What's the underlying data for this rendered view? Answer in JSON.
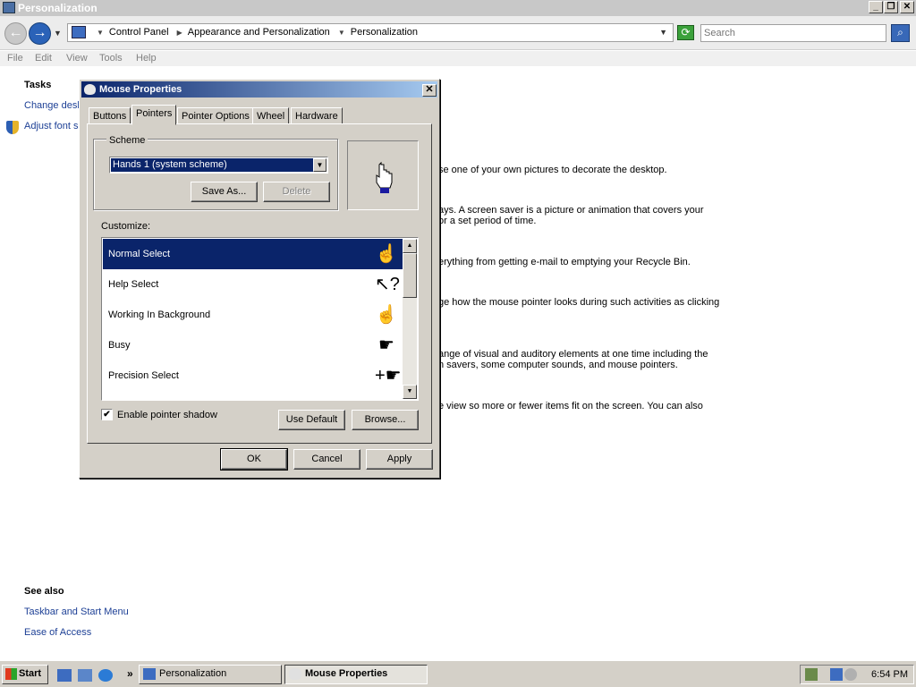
{
  "window": {
    "title": "Personalization",
    "controls": {
      "minimize": "_",
      "maximize": "❐",
      "close": "✕"
    }
  },
  "address": {
    "breadcrumbs": [
      "Control Panel",
      "Appearance and Personalization",
      "Personalization"
    ],
    "search_placeholder": "Search"
  },
  "menu": [
    "File",
    "Edit",
    "View",
    "Tools",
    "Help"
  ],
  "page": {
    "tasks_heading": "Tasks",
    "tasks": [
      "Change desk",
      "Adjust font s"
    ],
    "descriptions": [
      "se one of your own pictures to decorate the desktop.",
      "ays. A screen saver is a picture or animation that covers your",
      "or a set period of time.",
      "erything from getting e-mail to emptying your Recycle Bin.",
      "ge how the mouse pointer looks during such activities as clicking",
      "ange of visual and auditory elements at one time including the",
      "n savers, some computer sounds, and mouse pointers.",
      "e view so more or fewer items fit on the screen. You can also"
    ],
    "see_also_heading": "See also",
    "see_also": [
      "Taskbar and Start Menu",
      "Ease of Access"
    ]
  },
  "dialog": {
    "title": "Mouse Properties",
    "close": "✕",
    "tabs": [
      "Buttons",
      "Pointers",
      "Pointer Options",
      "Wheel",
      "Hardware"
    ],
    "active_tab": "Pointers",
    "scheme_label": "Scheme",
    "scheme_value": "Hands 1 (system scheme)",
    "save_as": "Save As...",
    "delete": "Delete",
    "customize_label": "Customize:",
    "pointers": [
      {
        "name": "Normal Select",
        "icon": "hand-pointer-icon",
        "glyph": "☝",
        "selected": true
      },
      {
        "name": "Help Select",
        "icon": "help-select-icon",
        "glyph": "↖?",
        "selected": false
      },
      {
        "name": "Working In Background",
        "icon": "working-background-icon",
        "glyph": "☝",
        "selected": false
      },
      {
        "name": "Busy",
        "icon": "busy-hand-icon",
        "glyph": "☛",
        "selected": false
      },
      {
        "name": "Precision Select",
        "icon": "precision-select-icon",
        "glyph": "+☛",
        "selected": false
      }
    ],
    "enable_shadow_label": "Enable pointer shadow",
    "enable_shadow_checked": "✔",
    "use_default": "Use Default",
    "browse": "Browse...",
    "ok": "OK",
    "cancel": "Cancel",
    "apply": "Apply"
  },
  "taskbar": {
    "start": "Start",
    "more": "»",
    "tasks": [
      "Personalization",
      "Mouse Properties"
    ],
    "clock": "6:54 PM"
  }
}
